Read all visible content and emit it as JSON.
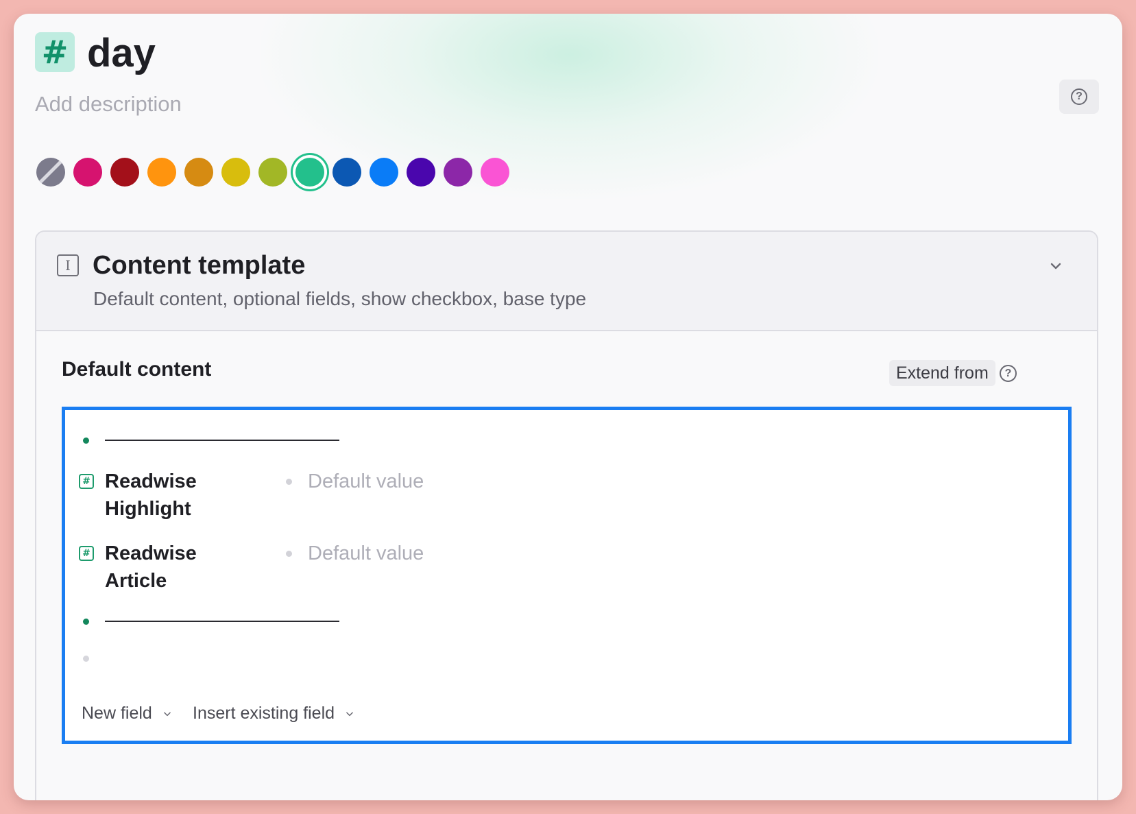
{
  "header": {
    "tag_icon_glyph": "#",
    "title": "day",
    "description_placeholder": "Add description",
    "help_glyph": "?"
  },
  "colors": [
    {
      "name": "none",
      "hex": "#7c7b8c",
      "selected": false
    },
    {
      "name": "pink",
      "hex": "#d6136f",
      "selected": false
    },
    {
      "name": "red",
      "hex": "#a3101a",
      "selected": false
    },
    {
      "name": "orange",
      "hex": "#ff940e",
      "selected": false
    },
    {
      "name": "amber",
      "hex": "#d68b12",
      "selected": false
    },
    {
      "name": "yellow",
      "hex": "#d8bd0d",
      "selected": false
    },
    {
      "name": "olive",
      "hex": "#a2b726",
      "selected": false
    },
    {
      "name": "green",
      "hex": "#23c08c",
      "selected": true
    },
    {
      "name": "navy",
      "hex": "#0c58b3",
      "selected": false
    },
    {
      "name": "blue",
      "hex": "#0a7cf7",
      "selected": false
    },
    {
      "name": "indigo",
      "hex": "#4a06ad",
      "selected": false
    },
    {
      "name": "purple",
      "hex": "#8c27a8",
      "selected": false
    },
    {
      "name": "magenta",
      "hex": "#fa54d4",
      "selected": false
    }
  ],
  "content_template": {
    "icon_glyph": "I",
    "title": "Content template",
    "subtitle": "Default content, optional fields, show checkbox, base type"
  },
  "default_content": {
    "label": "Default content",
    "extend_label": "Extend from",
    "help_glyph": "?",
    "fields": [
      {
        "icon_glyph": "#",
        "name": "Readwise Highlight",
        "value_placeholder": "Default value"
      },
      {
        "icon_glyph": "#",
        "name": "Readwise Article",
        "value_placeholder": "Default value"
      }
    ],
    "new_field_label": "New field",
    "insert_field_label": "Insert existing field"
  },
  "accent_color": "#1a7ef2"
}
